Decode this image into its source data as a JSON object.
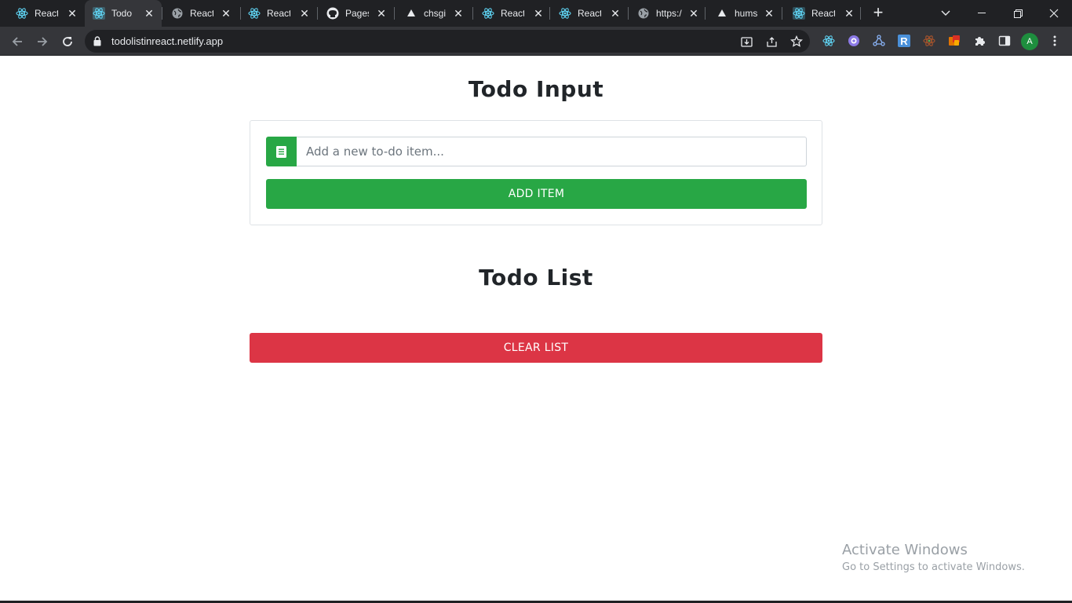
{
  "browser": {
    "tabs": [
      {
        "title": "React",
        "favicon": "react-icon"
      },
      {
        "title": "Todo L",
        "favicon": "react-icon",
        "active": true
      },
      {
        "title": "React",
        "favicon": "globe-icon"
      },
      {
        "title": "React",
        "favicon": "react-icon"
      },
      {
        "title": "Pages",
        "favicon": "github-icon"
      },
      {
        "title": "chsgi",
        "favicon": "vercel-icon"
      },
      {
        "title": "React",
        "favicon": "react-icon"
      },
      {
        "title": "React",
        "favicon": "react-icon"
      },
      {
        "title": "https:/",
        "favicon": "globe-icon"
      },
      {
        "title": "hums",
        "favicon": "vercel-icon"
      },
      {
        "title": "React",
        "favicon": "react-icon"
      }
    ],
    "new_tab": "+",
    "url": "todolistinreact.netlify.app",
    "profile_initial": "A"
  },
  "page": {
    "input_heading": "Todo Input",
    "input_placeholder": "Add a new to-do item...",
    "add_button": "ADD ITEM",
    "list_heading": "Todo List",
    "clear_button": "CLEAR LIST"
  },
  "watermark": {
    "line1": "Activate Windows",
    "line2": "Go to Settings to activate Windows."
  },
  "colors": {
    "success": "#28a745",
    "danger": "#dc3545",
    "chrome_dark": "#202124",
    "chrome_toolbar": "#35363a"
  }
}
